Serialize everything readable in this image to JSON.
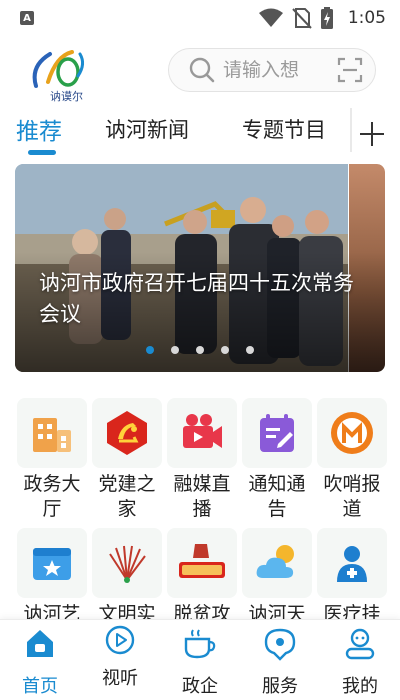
{
  "status_bar": {
    "app_letter": "A",
    "time": "1:05"
  },
  "header": {
    "logo_text": "讷谟尔",
    "search": {
      "placeholder": "请输入想",
      "value": ""
    }
  },
  "tabs": [
    {
      "label": "推荐",
      "active": true
    },
    {
      "label": "讷河新闻",
      "active": false
    },
    {
      "label": "专题节目",
      "active": false
    }
  ],
  "banner": {
    "caption": "讷河市政府召开七届四十五次常务会议",
    "slide_count": 5,
    "active_slide": 1
  },
  "services": [
    {
      "label": "政务大厅",
      "icon": "government-hall-icon"
    },
    {
      "label": "党建之家",
      "icon": "party-building-icon"
    },
    {
      "label": "融媒直播",
      "icon": "live-video-icon"
    },
    {
      "label": "通知通告",
      "icon": "notice-icon"
    },
    {
      "label": "吹哨报道",
      "icon": "whistle-report-icon"
    },
    {
      "label": "讷河艺",
      "icon": "art-calendar-icon"
    },
    {
      "label": "文明实",
      "icon": "civilization-icon"
    },
    {
      "label": "脱贫攻",
      "icon": "poverty-alleviation-icon"
    },
    {
      "label": "讷河天",
      "icon": "weather-icon"
    },
    {
      "label": "医疗挂",
      "icon": "medical-icon"
    }
  ],
  "bottom_nav": [
    {
      "label": "首页",
      "icon": "home-icon",
      "active": true
    },
    {
      "label": "视听",
      "icon": "play-icon",
      "active": false
    },
    {
      "label": "政企",
      "icon": "cup-icon",
      "active": false
    },
    {
      "label": "服务",
      "icon": "location-chat-icon",
      "active": false
    },
    {
      "label": "我的",
      "icon": "profile-icon",
      "active": false
    }
  ],
  "colors": {
    "accent": "#1a8bd0",
    "party_red": "#d9261c",
    "notice_purple": "#8a5ad8",
    "whistle_orange": "#ef7d1a"
  }
}
